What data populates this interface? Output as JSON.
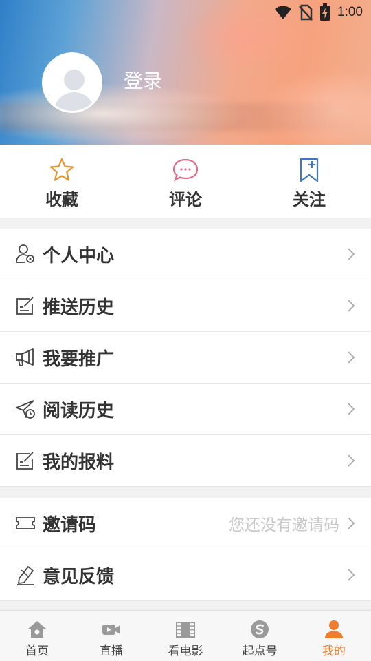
{
  "status_bar": {
    "time": "1:00",
    "icons": [
      "wifi-icon",
      "no-sim-icon",
      "battery-charging-icon"
    ]
  },
  "profile": {
    "login_label": "登录"
  },
  "quick_actions": [
    {
      "label": "收藏",
      "icon": "star-icon",
      "color": "#e8922e"
    },
    {
      "label": "评论",
      "icon": "comment-icon",
      "color": "#e56a86"
    },
    {
      "label": "关注",
      "icon": "bookmark-plus-icon",
      "color": "#3f74c6"
    }
  ],
  "menu_group_1": [
    {
      "label": "个人中心",
      "icon": "user-settings-icon"
    },
    {
      "label": "推送历史",
      "icon": "edit-note-icon"
    },
    {
      "label": "我要推广",
      "icon": "megaphone-icon"
    },
    {
      "label": "阅读历史",
      "icon": "send-clock-icon"
    },
    {
      "label": "我的报料",
      "icon": "edit-note-icon"
    }
  ],
  "menu_group_2": [
    {
      "label": "邀请码",
      "icon": "ticket-icon",
      "hint": "您还没有邀请码"
    },
    {
      "label": "意见反馈",
      "icon": "pencil-icon"
    }
  ],
  "tabbar": [
    {
      "label": "首页",
      "icon": "home-icon",
      "active": false
    },
    {
      "label": "直播",
      "icon": "video-camera-icon",
      "active": false
    },
    {
      "label": "看电影",
      "icon": "film-icon",
      "active": false
    },
    {
      "label": "起点号",
      "icon": "s-coin-icon",
      "active": false
    },
    {
      "label": "我的",
      "icon": "person-icon",
      "active": true
    }
  ],
  "colors": {
    "accent": "#f07c2e",
    "inactive_icon": "#9a9a9a"
  }
}
